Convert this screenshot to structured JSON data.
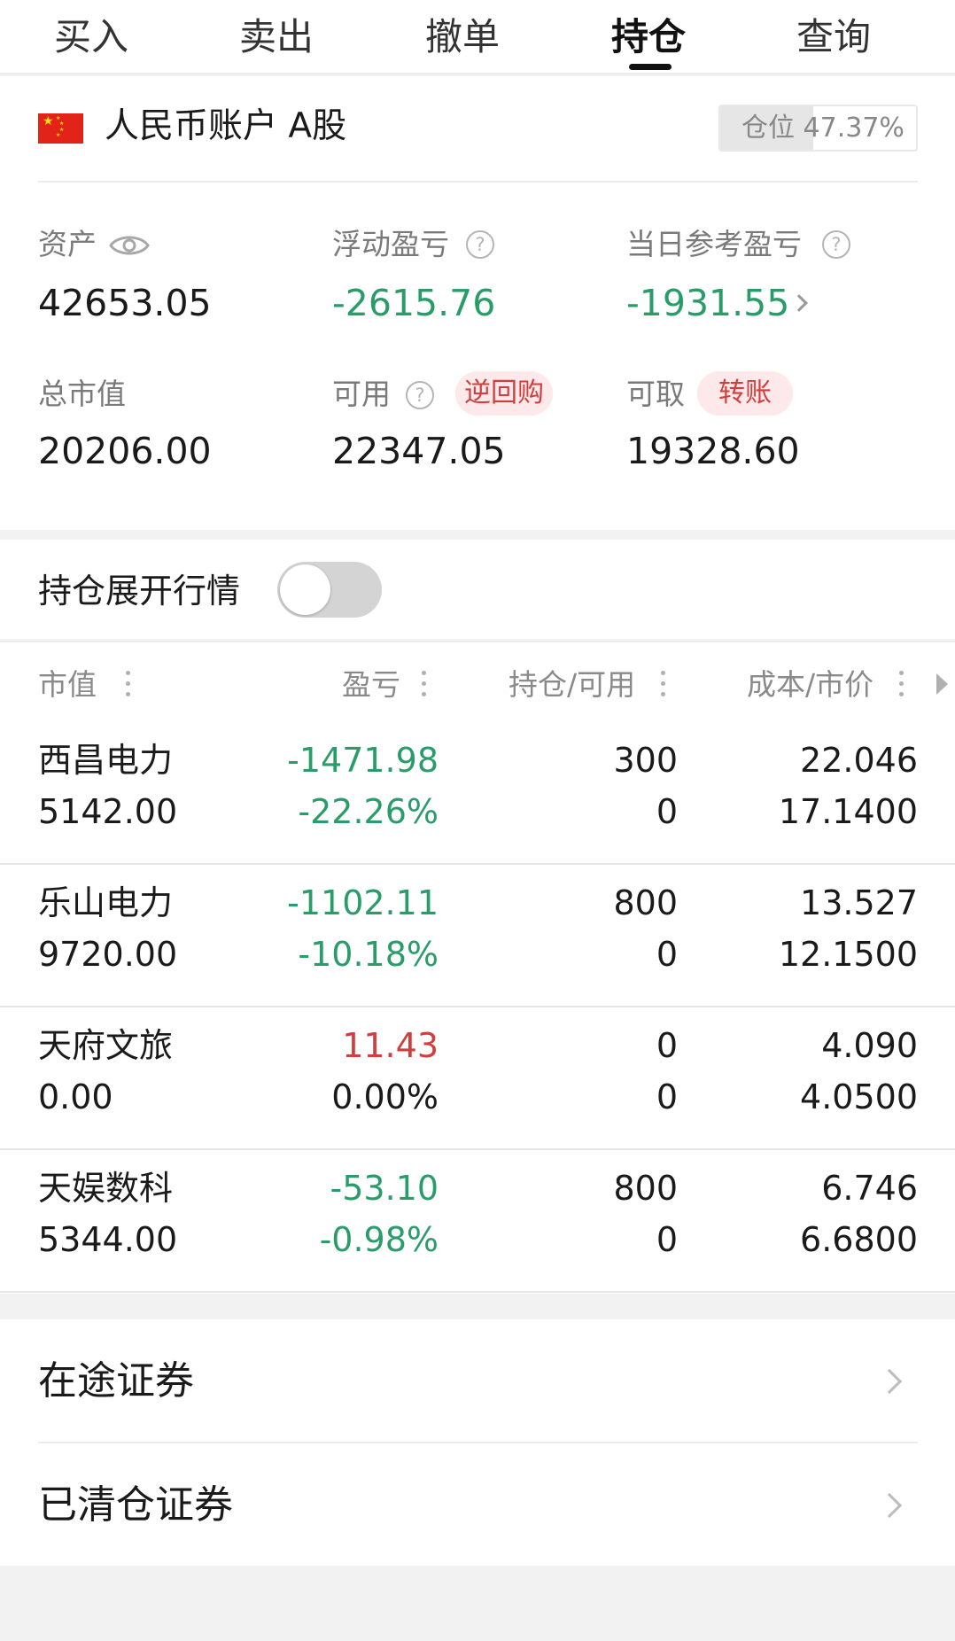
{
  "tabs": [
    {
      "label": "买入",
      "active": false
    },
    {
      "label": "卖出",
      "active": false
    },
    {
      "label": "撤单",
      "active": false
    },
    {
      "label": "持仓",
      "active": true
    },
    {
      "label": "查询",
      "active": false
    }
  ],
  "account": {
    "flag_icon": "china-flag-icon",
    "name": "人民币账户 A股",
    "position_label": "仓位 47.37%",
    "position_ratio": 0.4737
  },
  "metrics": {
    "assets_label": "资产",
    "assets_value": "42653.05",
    "floating_pl_label": "浮动盈亏",
    "floating_pl_value": "-2615.76",
    "daily_pl_label": "当日参考盈亏",
    "daily_pl_value": "-1931.55",
    "market_value_label": "总市值",
    "market_value_value": "20206.00",
    "available_label": "可用",
    "available_value": "22347.05",
    "reverse_repo_label": "逆回购",
    "withdrawable_label": "可取",
    "withdrawable_value": "19328.60",
    "transfer_label": "转账"
  },
  "toggle": {
    "label": "持仓展开行情",
    "on": false
  },
  "table": {
    "headers": [
      "市值",
      "盈亏",
      "持仓/可用",
      "成本/市价"
    ],
    "rows": [
      {
        "name": "西昌电力",
        "market_value": "5142.00",
        "pl": "-1471.98",
        "pl_pct": "-22.26%",
        "holding": "300",
        "available": "0",
        "cost": "22.046",
        "price": "17.1400",
        "trend": "down"
      },
      {
        "name": "乐山电力",
        "market_value": "9720.00",
        "pl": "-1102.11",
        "pl_pct": "-10.18%",
        "holding": "800",
        "available": "0",
        "cost": "13.527",
        "price": "12.1500",
        "trend": "down"
      },
      {
        "name": "天府文旅",
        "market_value": "0.00",
        "pl": "11.43",
        "pl_pct": "0.00%",
        "holding": "0",
        "available": "0",
        "cost": "4.090",
        "price": "4.0500",
        "trend": "up"
      },
      {
        "name": "天娱数科",
        "market_value": "5344.00",
        "pl": "-53.10",
        "pl_pct": "-0.98%",
        "holding": "800",
        "available": "0",
        "cost": "6.746",
        "price": "6.6800",
        "trend": "down"
      }
    ]
  },
  "links": [
    {
      "label": "在途证券"
    },
    {
      "label": "已清仓证券"
    }
  ],
  "colors": {
    "loss": "#2a9c6a",
    "gain": "#d23e3e"
  }
}
